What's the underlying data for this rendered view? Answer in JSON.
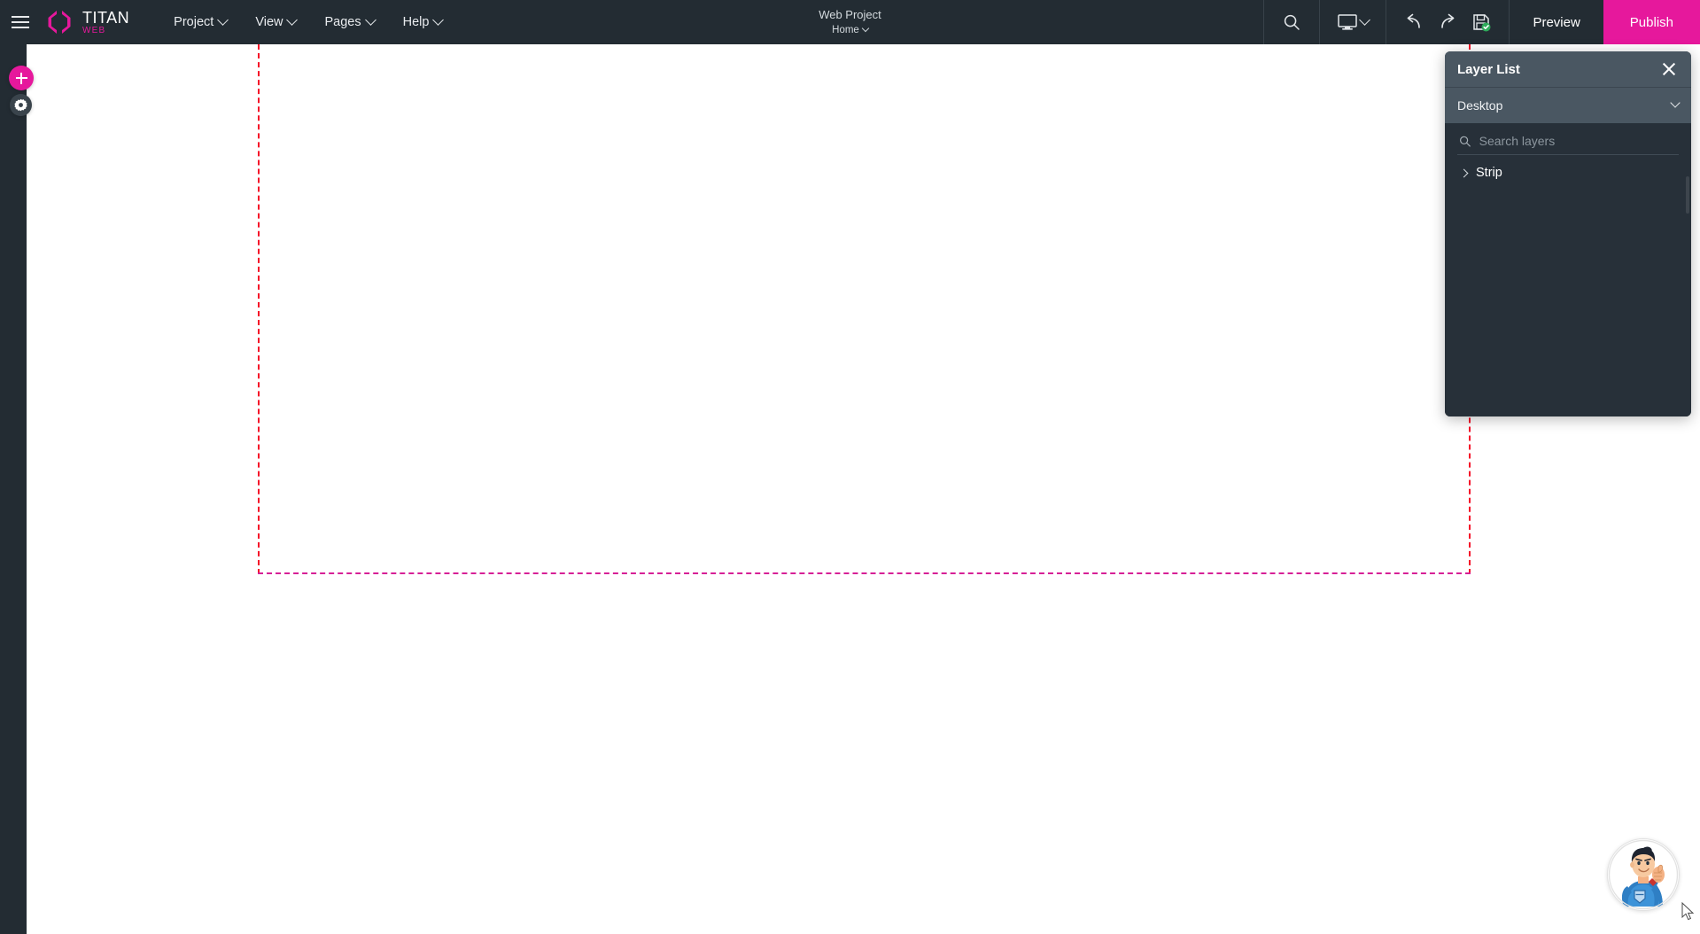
{
  "app": {
    "logo_title": "TITAN",
    "logo_subtitle": "WEB",
    "brand_color": "#e6189c",
    "topbar_color": "#232c33"
  },
  "topbar": {
    "menus": [
      {
        "label": "Project",
        "icon": "chevron-down-icon"
      },
      {
        "label": "View",
        "icon": "chevron-down-icon"
      },
      {
        "label": "Pages",
        "icon": "chevron-down-icon"
      },
      {
        "label": "Help",
        "icon": "chevron-down-icon"
      }
    ],
    "project_name": "Web Project",
    "current_page": "Home",
    "tools": {
      "search": "search-icon",
      "device": "desktop-monitor-icon",
      "undo": "undo-arrow-icon",
      "redo": "redo-arrow-icon",
      "save": "floppy-save-icon",
      "save_status": "saved"
    },
    "preview_label": "Preview",
    "publish_label": "Publish"
  },
  "sidebar": {
    "buttons": [
      {
        "name": "add-element",
        "icon": "plus-icon",
        "color": "#e6189c"
      },
      {
        "name": "settings",
        "icon": "gear-icon",
        "color": "#3a444c"
      }
    ]
  },
  "layer_panel": {
    "title": "Layer List",
    "close_icon": "close-icon",
    "viewport": "Desktop",
    "viewport_icon": "chevron-down-icon",
    "search_placeholder": "Search layers",
    "search_value": "",
    "search_icon": "search-icon",
    "layers": [
      {
        "label": "Strip",
        "expanded": false,
        "icon": "chevron-right-icon"
      }
    ]
  },
  "canvas": {
    "guide_color_red": "#f50f28",
    "guide_color_magenta": "#d61f96",
    "background": "#ffffff"
  },
  "mascot": {
    "name": "support-hero-avatar",
    "description": "blue superhero thumbs-up"
  }
}
